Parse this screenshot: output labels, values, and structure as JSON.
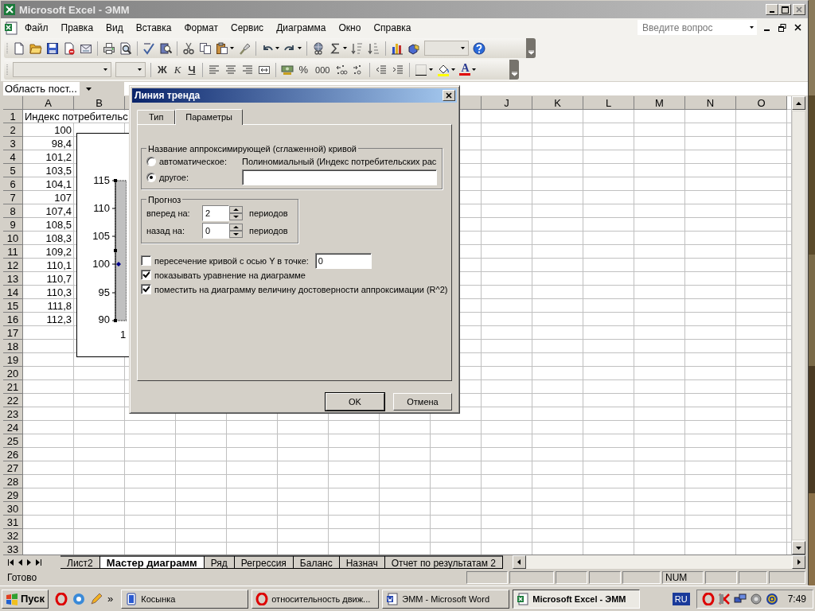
{
  "window": {
    "title": "Microsoft Excel - ЭММ",
    "active": false
  },
  "menu": [
    "Файл",
    "Правка",
    "Вид",
    "Вставка",
    "Формат",
    "Сервис",
    "Диаграмма",
    "Окно",
    "Справка"
  ],
  "question_box": {
    "placeholder": "Введите вопрос"
  },
  "formatting_toolbar": {
    "bold": "Ж",
    "italic": "К",
    "underline": "Ч",
    "percent": "%",
    "thousands": "000",
    "font_color": "A"
  },
  "name_box": {
    "value": "Область пост..."
  },
  "sheet": {
    "columns": [
      {
        "label": "A"
      },
      {
        "label": "B"
      },
      {
        "label": "J",
        "gap_before": true
      },
      {
        "label": "K"
      },
      {
        "label": "L"
      },
      {
        "label": "M"
      },
      {
        "label": "N"
      },
      {
        "label": "O"
      }
    ],
    "rows": [
      {
        "header": "1",
        "cells": [
          {
            "text": "Индекс потребительс",
            "kind": "text"
          }
        ]
      },
      {
        "header": "2",
        "cells": [
          {
            "text": "100",
            "kind": "number"
          }
        ]
      },
      {
        "header": "3",
        "cells": [
          {
            "text": "98,4",
            "kind": "number"
          }
        ]
      },
      {
        "header": "4",
        "cells": [
          {
            "text": "101,2",
            "kind": "number"
          }
        ]
      },
      {
        "header": "5",
        "cells": [
          {
            "text": "103,5",
            "kind": "number"
          }
        ]
      },
      {
        "header": "6",
        "cells": [
          {
            "text": "104,1",
            "kind": "number"
          }
        ]
      },
      {
        "header": "7",
        "cells": [
          {
            "text": "107",
            "kind": "number"
          }
        ]
      },
      {
        "header": "8",
        "cells": [
          {
            "text": "107,4",
            "kind": "number"
          }
        ]
      },
      {
        "header": "9",
        "cells": [
          {
            "text": "108,5",
            "kind": "number"
          }
        ]
      },
      {
        "header": "10",
        "cells": [
          {
            "text": "108,3",
            "kind": "number"
          }
        ]
      },
      {
        "header": "11",
        "cells": [
          {
            "text": "109,2",
            "kind": "number"
          }
        ]
      },
      {
        "header": "12",
        "cells": [
          {
            "text": "110,1",
            "kind": "number"
          }
        ]
      },
      {
        "header": "13",
        "cells": [
          {
            "text": "110,7",
            "kind": "number"
          }
        ]
      },
      {
        "header": "14",
        "cells": [
          {
            "text": "110,3",
            "kind": "number"
          }
        ]
      },
      {
        "header": "15",
        "cells": [
          {
            "text": "111,8",
            "kind": "number"
          }
        ]
      },
      {
        "header": "16",
        "cells": [
          {
            "text": "112,3",
            "kind": "number"
          }
        ]
      },
      {
        "header": "17"
      },
      {
        "header": "18"
      },
      {
        "header": "19"
      },
      {
        "header": "20"
      },
      {
        "header": "21"
      },
      {
        "header": "22"
      },
      {
        "header": "23"
      },
      {
        "header": "24"
      },
      {
        "header": "25"
      },
      {
        "header": "26"
      },
      {
        "header": "27"
      },
      {
        "header": "28"
      },
      {
        "header": "29"
      },
      {
        "header": "30"
      },
      {
        "header": "31"
      },
      {
        "header": "32"
      },
      {
        "header": "33"
      }
    ]
  },
  "chart": {
    "y_tick_labels": [
      "115",
      "110",
      "105",
      "100",
      "95",
      "90"
    ],
    "x_tick_labels": [
      "1"
    ]
  },
  "dialog": {
    "title": "Линия тренда",
    "tabs": [
      {
        "label": "Тип",
        "selected": false
      },
      {
        "label": "Параметры",
        "selected": true
      }
    ],
    "name_group": {
      "legend": "Название аппроксимирующей (сглаженной) кривой",
      "options": [
        {
          "label": "автоматическое:",
          "selected": false,
          "kind": "text",
          "text": "Полиномиальный (Индекс потребительских рас"
        },
        {
          "label": "другое:",
          "selected": true,
          "kind": "field"
        }
      ]
    },
    "forecast": {
      "legend": "Прогноз",
      "rows": [
        {
          "label": "вперед на:",
          "value": "2",
          "unit": "периодов"
        },
        {
          "label": "назад на:",
          "value": "0",
          "unit": "периодов"
        }
      ]
    },
    "options": [
      {
        "label": "пересечение кривой с осью Y в точке:",
        "checked": false,
        "value": "0"
      },
      {
        "label": "показывать уравнение на диаграмме",
        "checked": true
      },
      {
        "label": "поместить на диаграмму величину достоверности аппроксимации (R^2)",
        "checked": true
      }
    ],
    "buttons": [
      "OK",
      "Отмена"
    ]
  },
  "sheet_tabs": [
    {
      "label": "Лист2",
      "selected": false
    },
    {
      "label": "Мастер диаграмм",
      "selected": true
    },
    {
      "label": "Ряд",
      "selected": false
    },
    {
      "label": "Регрессия",
      "selected": false
    },
    {
      "label": "Баланс",
      "selected": false
    },
    {
      "label": "Назнач",
      "selected": false
    },
    {
      "label": "Отчет по результатам 2",
      "selected": false
    }
  ],
  "status_bar": {
    "status": "Готово",
    "indicators": [
      "NUM"
    ]
  },
  "taskbar": {
    "start": "Пуск",
    "more": "»",
    "tasks": [
      {
        "label": "Косынка",
        "selected": false,
        "kind": "cards"
      },
      {
        "label": "относительность движ...",
        "selected": false,
        "kind": "opera"
      },
      {
        "label": "ЭММ - Microsoft Word",
        "selected": false,
        "kind": "word"
      },
      {
        "label": "Microsoft Excel - ЭММ",
        "selected": true,
        "kind": "excel"
      }
    ],
    "language": "RU",
    "clock": "7:49"
  }
}
